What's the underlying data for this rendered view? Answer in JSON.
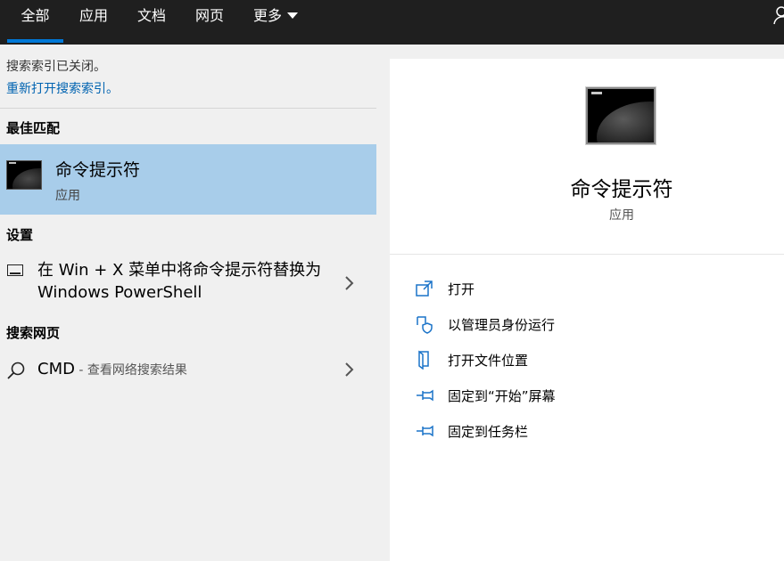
{
  "tabs": {
    "all": "全部",
    "apps": "应用",
    "documents": "文档",
    "web": "网页",
    "more": "更多"
  },
  "notice": {
    "message": "搜索索引已关闭。",
    "link": "重新打开搜索索引。"
  },
  "sections": {
    "best_match": "最佳匹配",
    "settings": "设置",
    "search_web": "搜索网页"
  },
  "best_match": {
    "title": "命令提示符",
    "subtitle": "应用",
    "icon": "command-prompt-icon"
  },
  "setting_item": {
    "text": "在 Win + X 菜单中将命令提示符替换为 Windows PowerShell",
    "icon": "monitor-icon"
  },
  "web_item": {
    "query": "CMD",
    "suffix": " - 查看网络搜索结果",
    "icon": "search-icon"
  },
  "detail": {
    "title": "命令提示符",
    "subtitle": "应用",
    "actions": [
      {
        "label": "打开",
        "icon": "open-icon"
      },
      {
        "label": "以管理员身份运行",
        "icon": "shield-icon"
      },
      {
        "label": "打开文件位置",
        "icon": "file-location-icon"
      },
      {
        "label": "固定到“开始”屏幕",
        "icon": "pin-icon"
      },
      {
        "label": "固定到任务栏",
        "icon": "pin-icon"
      }
    ]
  },
  "colors": {
    "accent": "#0078d7",
    "link": "#0063b1",
    "selection": "#a8cdea",
    "topbar": "#1f1f1f",
    "icon_blue": "#1a73c8"
  }
}
